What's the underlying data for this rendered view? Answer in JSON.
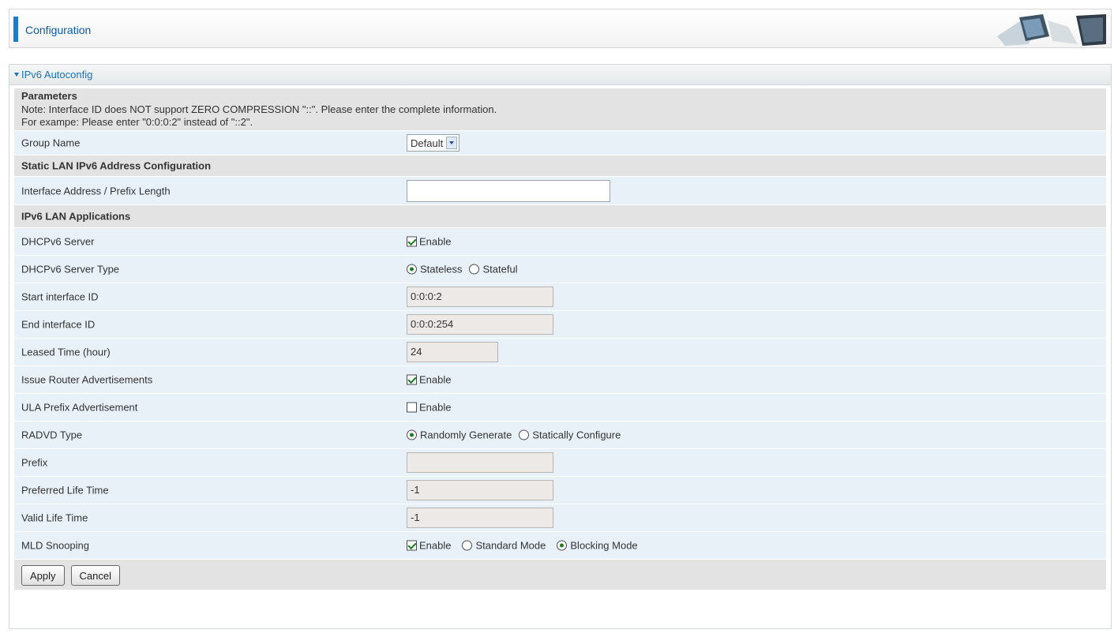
{
  "header": {
    "title": "Configuration"
  },
  "panel": {
    "title": "IPv6 Autoconfig"
  },
  "parameters": {
    "heading": "Parameters",
    "note_line1": "Note: Interface ID does NOT support ZERO COMPRESSION \"::\". Please enter the complete information.",
    "note_line2": "For exampe: Please enter \"0:0:0:2\" instead of \"::2\"."
  },
  "group_name": {
    "label": "Group Name",
    "value": "Default"
  },
  "static_section": {
    "heading": "Static LAN IPv6 Address Configuration"
  },
  "interface_address": {
    "label": "Interface Address / Prefix Length",
    "value": ""
  },
  "apps_section": {
    "heading": "IPv6 LAN Applications"
  },
  "dhcpv6_server": {
    "label": "DHCPv6 Server",
    "option": "Enable",
    "checked": true
  },
  "dhcpv6_type": {
    "label": "DHCPv6 Server Type",
    "options": [
      "Stateless",
      "Stateful"
    ],
    "selected": "Stateless"
  },
  "start_id": {
    "label": "Start interface ID",
    "value": "0:0:0:2"
  },
  "end_id": {
    "label": "End interface ID",
    "value": "0:0:0:254"
  },
  "leased_time": {
    "label": "Leased Time (hour)",
    "value": "24"
  },
  "issue_ra": {
    "label": "Issue Router Advertisements",
    "option": "Enable",
    "checked": true
  },
  "ula_prefix": {
    "label": "ULA Prefix Advertisement",
    "option": "Enable",
    "checked": false
  },
  "radvd_type": {
    "label": "RADVD Type",
    "options": [
      "Randomly Generate",
      "Statically Configure"
    ],
    "selected": "Randomly Generate"
  },
  "prefix": {
    "label": "Prefix",
    "value": ""
  },
  "preferred_life": {
    "label": "Preferred Life Time",
    "value": "-1"
  },
  "valid_life": {
    "label": "Valid Life Time",
    "value": "-1"
  },
  "mld_snooping": {
    "label": "MLD Snooping",
    "enable": "Enable",
    "enable_checked": true,
    "options": [
      "Standard Mode",
      "Blocking Mode"
    ],
    "selected": "Blocking Mode"
  },
  "actions": {
    "apply": "Apply",
    "cancel": "Cancel"
  }
}
